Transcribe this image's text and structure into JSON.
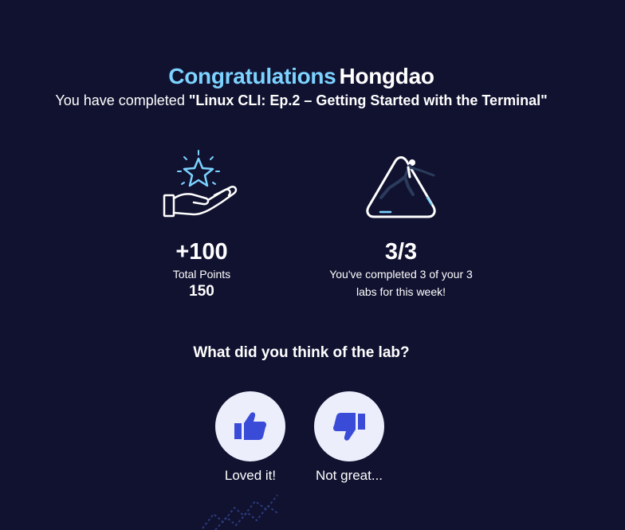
{
  "header": {
    "congrats": "Congratulations",
    "username": "Hongdao",
    "completed_prefix": "You have completed ",
    "lab_title": "\"Linux CLI: Ep.2 – Getting Started with the Terminal\""
  },
  "stats": {
    "points": {
      "icon": "hand-star-icon",
      "value": "+100",
      "label": "Total Points",
      "total": "150"
    },
    "labs": {
      "icon": "hurdle-runner-icon",
      "value": "3/3",
      "text_line1": "You've completed 3 of your 3",
      "text_line2": "labs for this week!"
    }
  },
  "feedback": {
    "question": "What did you think of the lab?",
    "like_label": "Loved it!",
    "dislike_label": "Not great..."
  },
  "colors": {
    "background": "#111230",
    "accent": "#7cd3ff",
    "thumb": "#3a4bd8",
    "button_bg": "#eceefc"
  }
}
